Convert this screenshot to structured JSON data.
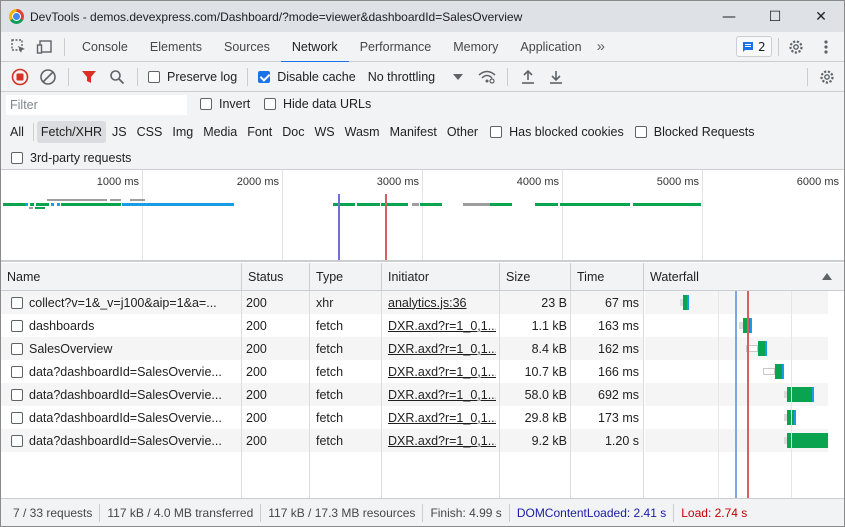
{
  "titlebar": {
    "title": "DevTools - demos.devexpress.com/Dashboard/?mode=viewer&dashboardId=SalesOverview",
    "minimize": "—",
    "maximize": "☐",
    "close": "✕"
  },
  "tabs": {
    "items": [
      {
        "label": "Console"
      },
      {
        "label": "Elements"
      },
      {
        "label": "Sources"
      },
      {
        "label": "Network",
        "active": true
      },
      {
        "label": "Performance"
      },
      {
        "label": "Memory"
      },
      {
        "label": "Application"
      }
    ],
    "more": "»",
    "issues_count": "2"
  },
  "toolbar": {
    "preserve_log": {
      "label": "Preserve log",
      "checked": false
    },
    "disable_cache": {
      "label": "Disable cache",
      "checked": true
    },
    "throttling": "No throttling"
  },
  "filter": {
    "placeholder": "Filter",
    "invert": {
      "label": "Invert",
      "checked": false
    },
    "hide_data_urls": {
      "label": "Hide data URLs",
      "checked": false
    },
    "types": [
      {
        "label": "All"
      },
      {
        "label": "Fetch/XHR",
        "active": true
      },
      {
        "label": "JS"
      },
      {
        "label": "CSS"
      },
      {
        "label": "Img"
      },
      {
        "label": "Media"
      },
      {
        "label": "Font"
      },
      {
        "label": "Doc"
      },
      {
        "label": "WS"
      },
      {
        "label": "Wasm"
      },
      {
        "label": "Manifest"
      },
      {
        "label": "Other"
      }
    ],
    "has_blocked_cookies": {
      "label": "Has blocked cookies",
      "checked": false
    },
    "blocked_requests": {
      "label": "Blocked Requests",
      "checked": false
    },
    "third_party": {
      "label": "3rd-party requests",
      "checked": false
    }
  },
  "overview": {
    "ticks": [
      "1000 ms",
      "2000 ms",
      "3000 ms",
      "4000 ms",
      "5000 ms",
      "6000 ms"
    ],
    "dom_content_loaded_ms": 2410,
    "load_ms": 2740,
    "colors": {
      "dcl": "#6f6fd6",
      "load": "#d96060",
      "green": "#0aa34f",
      "blue": "#1a9be6",
      "gray": "#9e9e9e"
    }
  },
  "table": {
    "headers": {
      "name": "Name",
      "status": "Status",
      "type": "Type",
      "initiator": "Initiator",
      "size": "Size",
      "time": "Time",
      "waterfall": "Waterfall"
    },
    "rows": [
      {
        "name": "collect?v=1&_v=j100&aip=1&a=...",
        "status": "200",
        "type": "xhr",
        "initiator": "analytics.js:36",
        "size": "23 B",
        "time": "67 ms"
      },
      {
        "name": "dashboards",
        "status": "200",
        "type": "fetch",
        "initiator": "DXR.axd?r=1_0,1...",
        "size": "1.1 kB",
        "time": "163 ms"
      },
      {
        "name": "SalesOverview",
        "status": "200",
        "type": "fetch",
        "initiator": "DXR.axd?r=1_0,1...",
        "size": "8.4 kB",
        "time": "162 ms"
      },
      {
        "name": "data?dashboardId=SalesOvervie...",
        "status": "200",
        "type": "fetch",
        "initiator": "DXR.axd?r=1_0,1...",
        "size": "10.7 kB",
        "time": "166 ms"
      },
      {
        "name": "data?dashboardId=SalesOvervie...",
        "status": "200",
        "type": "fetch",
        "initiator": "DXR.axd?r=1_0,1...",
        "size": "58.0 kB",
        "time": "692 ms"
      },
      {
        "name": "data?dashboardId=SalesOvervie...",
        "status": "200",
        "type": "fetch",
        "initiator": "DXR.axd?r=1_0,1...",
        "size": "29.8 kB",
        "time": "173 ms"
      },
      {
        "name": "data?dashboardId=SalesOvervie...",
        "status": "200",
        "type": "fetch",
        "initiator": "DXR.axd?r=1_0,1...",
        "size": "9.2 kB",
        "time": "1.20 s"
      }
    ]
  },
  "statusbar": {
    "requests": "7 / 33 requests",
    "transferred": "117 kB / 4.0 MB transferred",
    "resources": "117 kB / 17.3 MB resources",
    "finish": "Finish: 4.99 s",
    "dom_content_loaded": "DOMContentLoaded: 2.41 s",
    "load": "Load: 2.74 s",
    "dcl_color": "#1a1aa6",
    "load_color": "#c80000"
  }
}
